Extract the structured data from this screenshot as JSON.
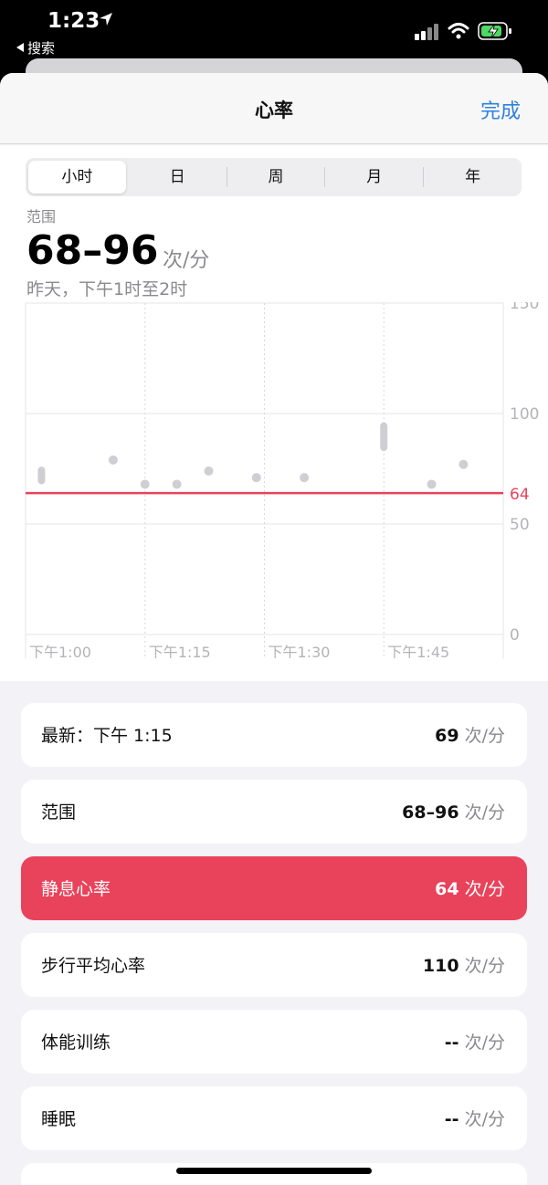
{
  "status_bar": {
    "time": "1:23",
    "back_label": "搜索"
  },
  "nav": {
    "title": "心率",
    "done": "完成"
  },
  "segments": [
    "小时",
    "日",
    "周",
    "月",
    "年"
  ],
  "selected_segment": 0,
  "summary": {
    "label": "范围",
    "value": "68–96",
    "unit": "次/分",
    "date": "昨天，下午1时至2时"
  },
  "colors": {
    "accent": "#2f80e0",
    "resting": "#e9435b",
    "points": "#cfcfd3"
  },
  "chart_data": {
    "type": "scatter",
    "x_tick_labels": [
      "下午1:00",
      "下午1:15",
      "下午1:30",
      "下午1:45"
    ],
    "x_range_minutes": [
      0,
      60
    ],
    "ylim": [
      0,
      150
    ],
    "y_ticks": [
      0,
      50,
      100,
      150
    ],
    "y_tick_labels": [
      "0",
      "50",
      "100",
      "150"
    ],
    "reference_line": {
      "value": 64,
      "label": "64"
    },
    "points": [
      {
        "minute": 2,
        "min": 68,
        "max": 76
      },
      {
        "minute": 11,
        "min": 79,
        "max": 79
      },
      {
        "minute": 15,
        "min": 68,
        "max": 68
      },
      {
        "minute": 19,
        "min": 68,
        "max": 68
      },
      {
        "minute": 23,
        "min": 74,
        "max": 74
      },
      {
        "minute": 29,
        "min": 71,
        "max": 71
      },
      {
        "minute": 35,
        "min": 71,
        "max": 71
      },
      {
        "minute": 45,
        "min": 83,
        "max": 96
      },
      {
        "minute": 51,
        "min": 68,
        "max": 68
      },
      {
        "minute": 55,
        "min": 77,
        "max": 77
      }
    ]
  },
  "list": [
    {
      "label": "最新：下午 1:15",
      "num": "69",
      "unit": "次/分",
      "highlight": false
    },
    {
      "label": "范围",
      "num": "68–96",
      "unit": "次/分",
      "highlight": false
    },
    {
      "label": "静息心率",
      "num": "64",
      "unit": "次/分",
      "highlight": true
    },
    {
      "label": "步行平均心率",
      "num": "110",
      "unit": "次/分",
      "highlight": false
    },
    {
      "label": "体能训练",
      "num": "--",
      "unit": "次/分",
      "highlight": false
    },
    {
      "label": "睡眠",
      "num": "--",
      "unit": "次/分",
      "highlight": false
    }
  ]
}
